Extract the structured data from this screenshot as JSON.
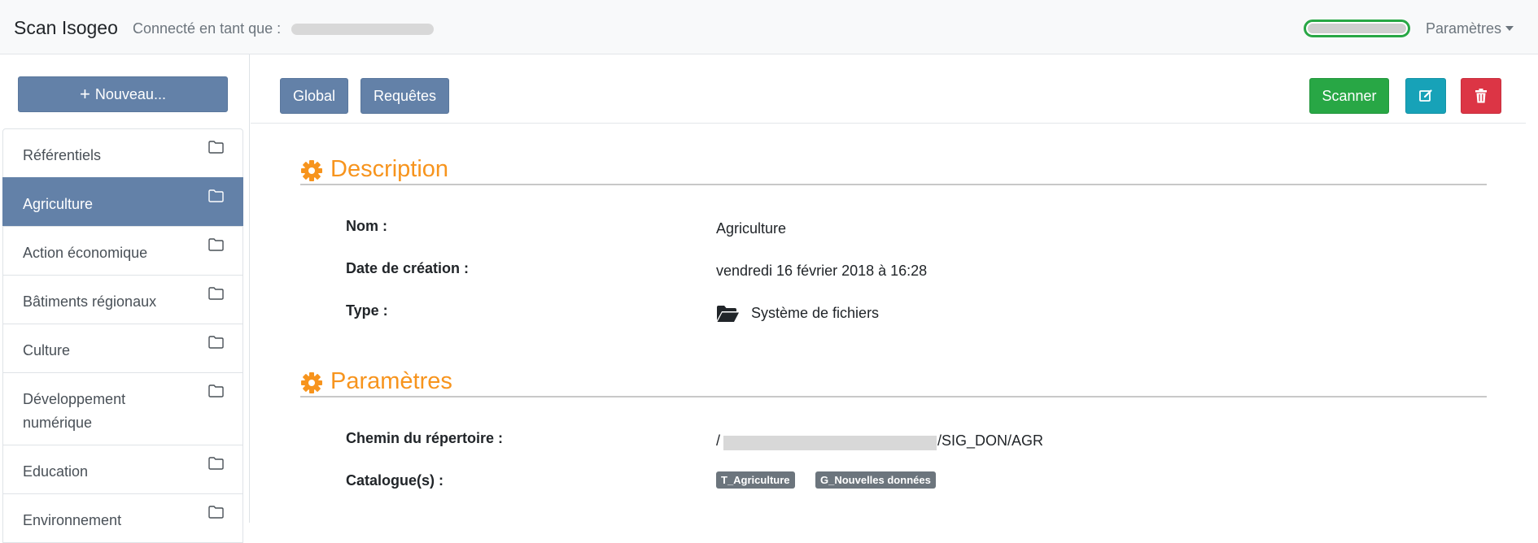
{
  "navbar": {
    "brand": "Scan Isogeo",
    "connected_label": "Connecté en tant que :",
    "settings_label": "Paramètres",
    "progress": 1.0
  },
  "sidebar": {
    "new_button_label": "Nouveau...",
    "items": [
      {
        "label": "Référentiels",
        "active": false
      },
      {
        "label": "Agriculture",
        "active": true
      },
      {
        "label": "Action économique",
        "active": false
      },
      {
        "label": "Bâtiments régionaux",
        "active": false
      },
      {
        "label": "Culture",
        "active": false
      },
      {
        "label": "Développement numérique",
        "active": false
      },
      {
        "label": "Education",
        "active": false
      },
      {
        "label": "Environnement",
        "active": false
      }
    ]
  },
  "toolbar": {
    "global_label": "Global",
    "queries_label": "Requêtes",
    "scan_label": "Scanner"
  },
  "description": {
    "title": "Description",
    "name_label": "Nom :",
    "name_value": "Agriculture",
    "date_label": "Date de création :",
    "date_value": "vendredi 16 février 2018 à 16:28",
    "type_label": "Type :",
    "type_value": "Système de fichiers"
  },
  "parameters": {
    "title": "Paramètres",
    "path_label": "Chemin du répertoire :",
    "path_value_prefix": "/",
    "path_value_suffix": "/SIG_DON/AGR",
    "catalogs_label": "Catalogue(s) :",
    "catalogs": [
      "T_Agriculture",
      "G_Nouvelles données"
    ]
  },
  "colors": {
    "primary": "#6381a8",
    "success": "#28a745",
    "info": "#17a2b8",
    "danger": "#dc3545",
    "accent": "#f7941d",
    "badge": "#6c757d"
  }
}
